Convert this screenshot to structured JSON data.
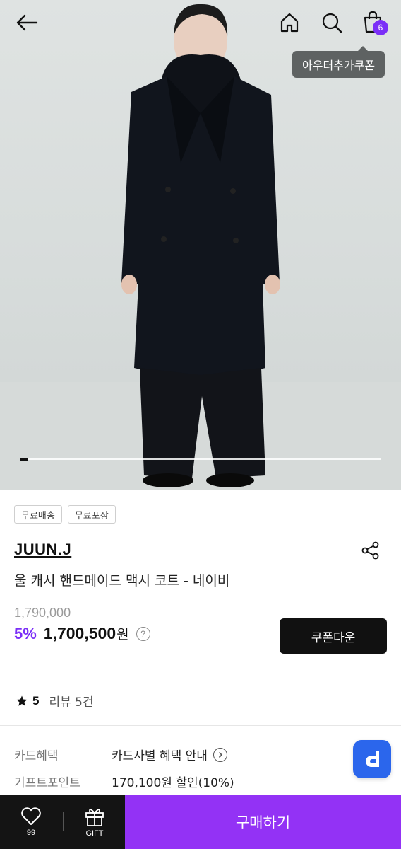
{
  "header": {
    "icons": [
      "back-arrow-icon",
      "home-icon",
      "search-icon",
      "cart-icon"
    ],
    "cart_count": "6",
    "coupon_tooltip": "아우터추가쿠폰"
  },
  "gallery": {
    "current_index": 1
  },
  "product": {
    "tags": [
      "무료배송",
      "무료포장"
    ],
    "brand": "JUUN.J",
    "name": "울 캐시 핸드메이드 맥시 코트 - 네이비",
    "original_price": "1,790,000",
    "discount": "5%",
    "price": "1,700,500",
    "currency": "원",
    "help_symbol": "?",
    "coupon_button": "쿠폰다운",
    "rating": "5",
    "review_link": "리뷰 5건"
  },
  "benefits": [
    {
      "label": "카드혜택",
      "value": "카드사별 혜택 안내"
    },
    {
      "label": "기프트포인트",
      "value": "170,100원 할인(10%)"
    }
  ],
  "bottom_bar": {
    "wish_count": "99",
    "gift_label": "GIFT",
    "buy_label": "구매하기"
  },
  "colors": {
    "accent": "#9332f5",
    "badge": "#7b2ff7",
    "dark": "#141414",
    "floating_button": "#2b66ec"
  }
}
